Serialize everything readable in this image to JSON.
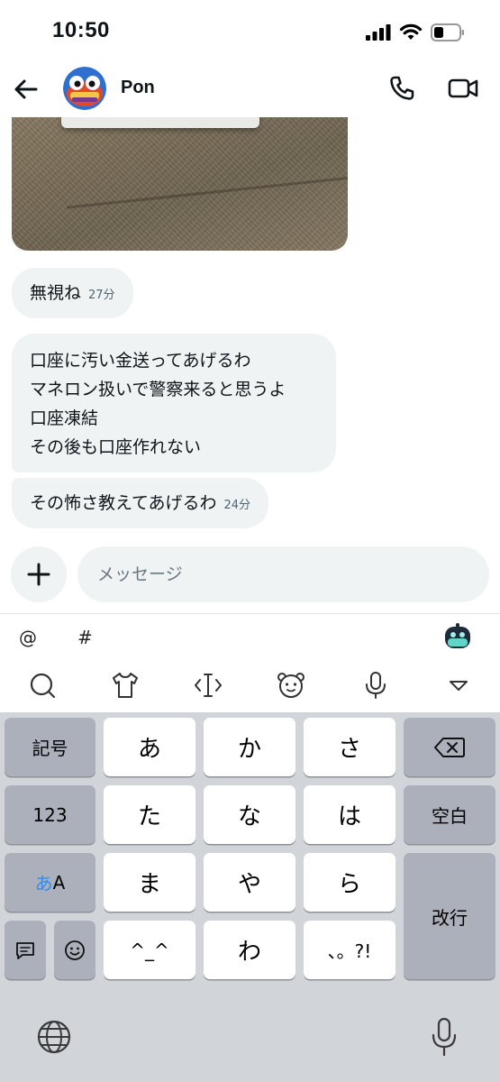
{
  "status_bar": {
    "time": "10:50"
  },
  "header": {
    "contact_name": "Pon"
  },
  "messages": [
    {
      "text": "無視ね",
      "time": "27分"
    },
    {
      "lines": [
        "口座に汚い金送ってあげるわ",
        "マネロン扱いで警察来ると思うよ",
        "口座凍結",
        "その後も口座作れない"
      ]
    },
    {
      "text": "その怖さ教えてあげるわ",
      "time": "24分"
    }
  ],
  "composer": {
    "placeholder": "メッセージ",
    "plus": "+"
  },
  "keyboard_toolbar": {
    "at": "@",
    "hash": "#"
  },
  "keyboard": {
    "row1": [
      "記号",
      "あ",
      "か",
      "さ"
    ],
    "row2": [
      "123",
      "た",
      "な",
      "は",
      "空白"
    ],
    "row3_kana": "あ",
    "row3_latin": "A",
    "row3": [
      "ま",
      "や",
      "ら"
    ],
    "row4": [
      "^_^",
      "わ",
      "、。?!"
    ],
    "enter": "改行"
  },
  "colors": {
    "bubble": "#eff3f4",
    "keyboard_bg": "#d1d4d9",
    "accent_blue": "#2f8cf0"
  }
}
